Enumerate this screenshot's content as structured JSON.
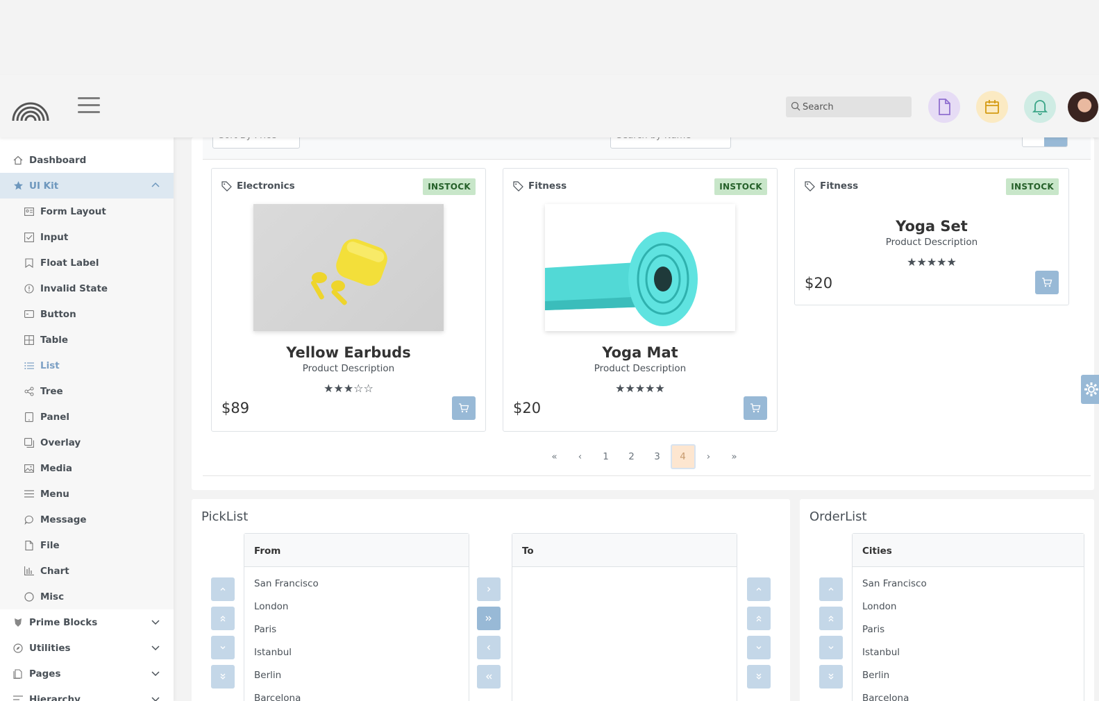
{
  "topbar": {
    "search_placeholder": "Search",
    "icons": [
      "file-icon",
      "calendar-icon",
      "bell-icon"
    ],
    "colors": {
      "file_bg": "#e6dcf5",
      "calendar_bg": "#fbeac3",
      "bell_bg": "#cfece4"
    }
  },
  "sidebar": {
    "items": [
      {
        "label": "Dashboard",
        "icon": "home-icon"
      },
      {
        "label": "UI Kit",
        "icon": "star-icon",
        "expanded": true
      },
      {
        "label": "Form Layout",
        "icon": "id-card-icon"
      },
      {
        "label": "Input",
        "icon": "check-square-icon"
      },
      {
        "label": "Float Label",
        "icon": "bookmark-icon"
      },
      {
        "label": "Invalid State",
        "icon": "exclamation-circle-icon"
      },
      {
        "label": "Button",
        "icon": "mobile-icon"
      },
      {
        "label": "Table",
        "icon": "table-icon"
      },
      {
        "label": "List",
        "icon": "list-icon"
      },
      {
        "label": "Tree",
        "icon": "share-icon"
      },
      {
        "label": "Panel",
        "icon": "tablet-icon"
      },
      {
        "label": "Overlay",
        "icon": "clone-icon"
      },
      {
        "label": "Media",
        "icon": "image-icon"
      },
      {
        "label": "Menu",
        "icon": "bars-icon"
      },
      {
        "label": "Message",
        "icon": "comment-icon"
      },
      {
        "label": "File",
        "icon": "file-icon"
      },
      {
        "label": "Chart",
        "icon": "chart-bar-icon"
      },
      {
        "label": "Misc",
        "icon": "circle-icon"
      },
      {
        "label": "Prime Blocks",
        "icon": "prime-icon"
      },
      {
        "label": "Utilities",
        "icon": "compass-icon"
      },
      {
        "label": "Pages",
        "icon": "briefcase-icon"
      },
      {
        "label": "Hierarchy",
        "icon": "align-left-icon"
      }
    ]
  },
  "toolbar": {
    "sort_placeholder": "Sort By Price",
    "name_placeholder": "Search by Name"
  },
  "products": [
    {
      "category": "Electronics",
      "status": "INSTOCK",
      "name": "Yellow Earbuds",
      "description": "Product Description",
      "rating": 3,
      "price": "$89",
      "image": "earbuds"
    },
    {
      "category": "Fitness",
      "status": "INSTOCK",
      "name": "Yoga Mat",
      "description": "Product Description",
      "rating": 5,
      "price": "$20",
      "image": "yoga-mat"
    },
    {
      "category": "Fitness",
      "status": "INSTOCK",
      "name": "Yoga Set",
      "description": "Product Description",
      "rating": 5,
      "price": "$20",
      "image": ""
    }
  ],
  "paginator": {
    "pages": [
      "1",
      "2",
      "3",
      "4"
    ],
    "current": "4",
    "first": "«",
    "prev": "‹",
    "next": "›",
    "last": "»"
  },
  "picklist": {
    "title": "PickList",
    "source_header": "From",
    "target_header": "To",
    "source_items": [
      "San Francisco",
      "London",
      "Paris",
      "Istanbul",
      "Berlin",
      "Barcelona"
    ]
  },
  "orderlist": {
    "title": "OrderList",
    "header": "Cities",
    "items": [
      "San Francisco",
      "London",
      "Paris",
      "Istanbul",
      "Berlin",
      "Barcelona"
    ]
  }
}
